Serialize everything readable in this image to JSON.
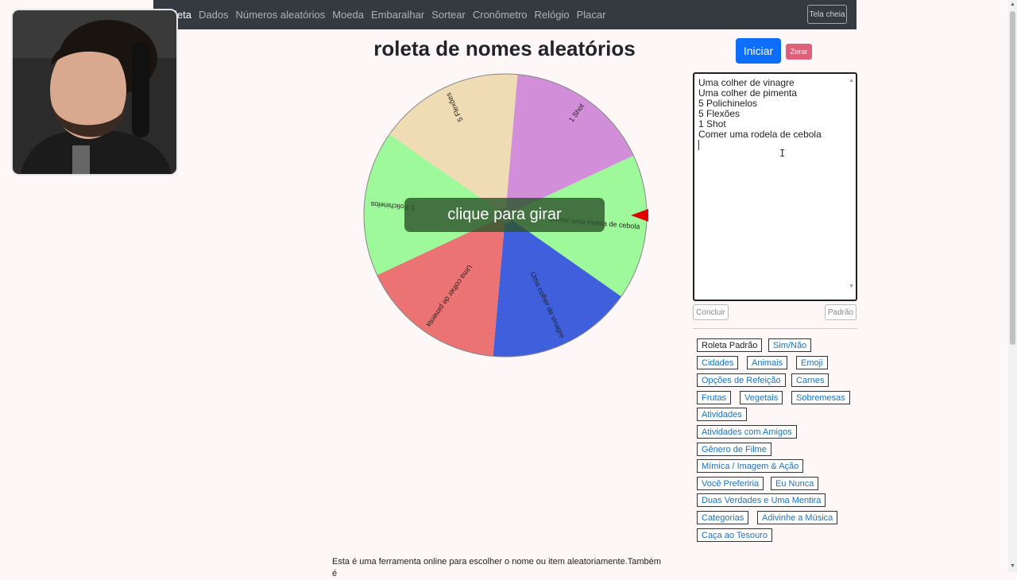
{
  "nav": {
    "links": [
      "leta",
      "Dados",
      "Números aleatórios",
      "Moeda",
      "Embaralhar",
      "Sortear",
      "Cronômetro",
      "Relógio",
      "Placar"
    ],
    "fullscreen": "Tela cheia"
  },
  "title": "roleta de nomes aleatórios",
  "wheel": {
    "overlay": "clique para girar",
    "segments": [
      {
        "label": "Comer uma rodela de cebola",
        "color": "#9ef99a"
      },
      {
        "label": "Uma colher de vinagre",
        "color": "#3f5fdc"
      },
      {
        "label": "Uma colher de pimenta",
        "color": "#ec7373"
      },
      {
        "label": "5 Polichinelos",
        "color": "#9ef99a"
      },
      {
        "label": "5 Flexões",
        "color": "#f0dcb4"
      },
      {
        "label": "1 Shot",
        "color": "#d28ed8"
      }
    ],
    "pointer_color": "#e00000"
  },
  "controls": {
    "start": "Iniciar",
    "reset": "Zerar",
    "done": "Concluir",
    "default": "Padrão"
  },
  "names": {
    "lines": [
      "Uma colher de vinagre",
      "Uma colher de pimenta",
      "5 Polichinelos",
      "5 Flexões",
      "1 Shot",
      "Comer uma rodela de cebola"
    ]
  },
  "presets": [
    "Roleta Padrão",
    "Sim/Não",
    "Cidades",
    "Animais",
    "Emoji",
    "Opções de Refeição",
    "Carnes",
    "Frutas",
    "Vegetais",
    "Sobremesas",
    "Atividades",
    "Atividades com Amigos",
    "Gênero de Filme",
    "Mímica / Imagem & Ação",
    "Você Preferiria",
    "Eu Nunca",
    "Duas Verdades e Uma Mentira",
    "Categorias",
    "Adivinhe a Música",
    "Caça ao Tesouro"
  ],
  "footer_text": "Esta é uma ferramenta online para escolher o nome ou item aleatoriamente.Também é",
  "colors": {
    "nav_bg": "#343a40",
    "primary": "#0d6efd",
    "danger": "#e0607a",
    "page_bg": "#fdf8f7"
  }
}
